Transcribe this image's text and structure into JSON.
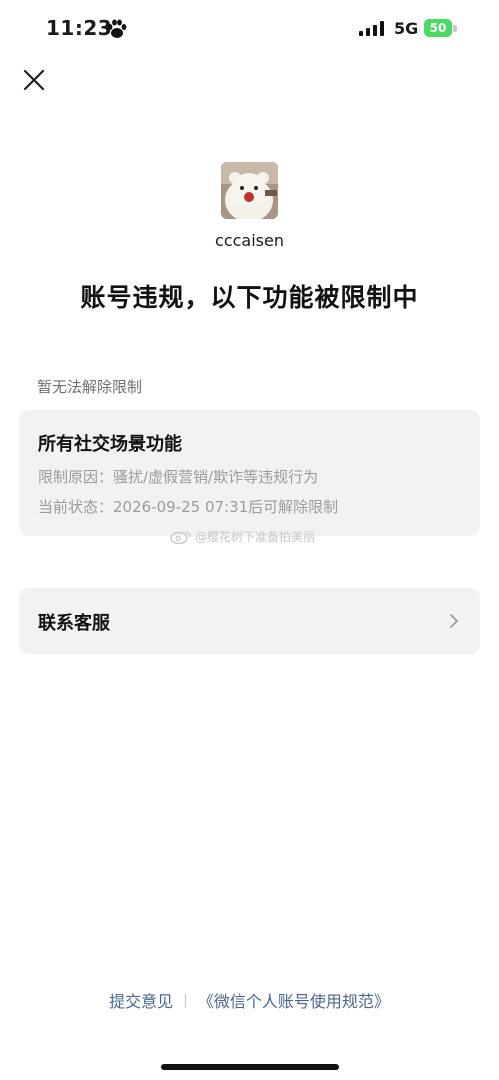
{
  "status_bar": {
    "time": "11:23",
    "network": "5G",
    "battery": "50"
  },
  "profile": {
    "username": "cccaisen"
  },
  "headline": "账号违规，以下功能被限制中",
  "restriction_section": {
    "label": "暂无法解除限制",
    "card": {
      "title": "所有社交场景功能",
      "reason": "限制原因：骚扰/虚假营销/欺诈等违规行为",
      "status": "当前状态：2026-09-25 07:31后可解除限制"
    }
  },
  "watermark": "@樱花树下准备拍美丽",
  "contact_service": {
    "label": "联系客服"
  },
  "footer": {
    "feedback": "提交意见",
    "policy": "《微信个人账号使用规范》"
  },
  "colors": {
    "link": "#4a6690",
    "card_bg": "#f2f2f2",
    "battery": "#4cd964"
  }
}
